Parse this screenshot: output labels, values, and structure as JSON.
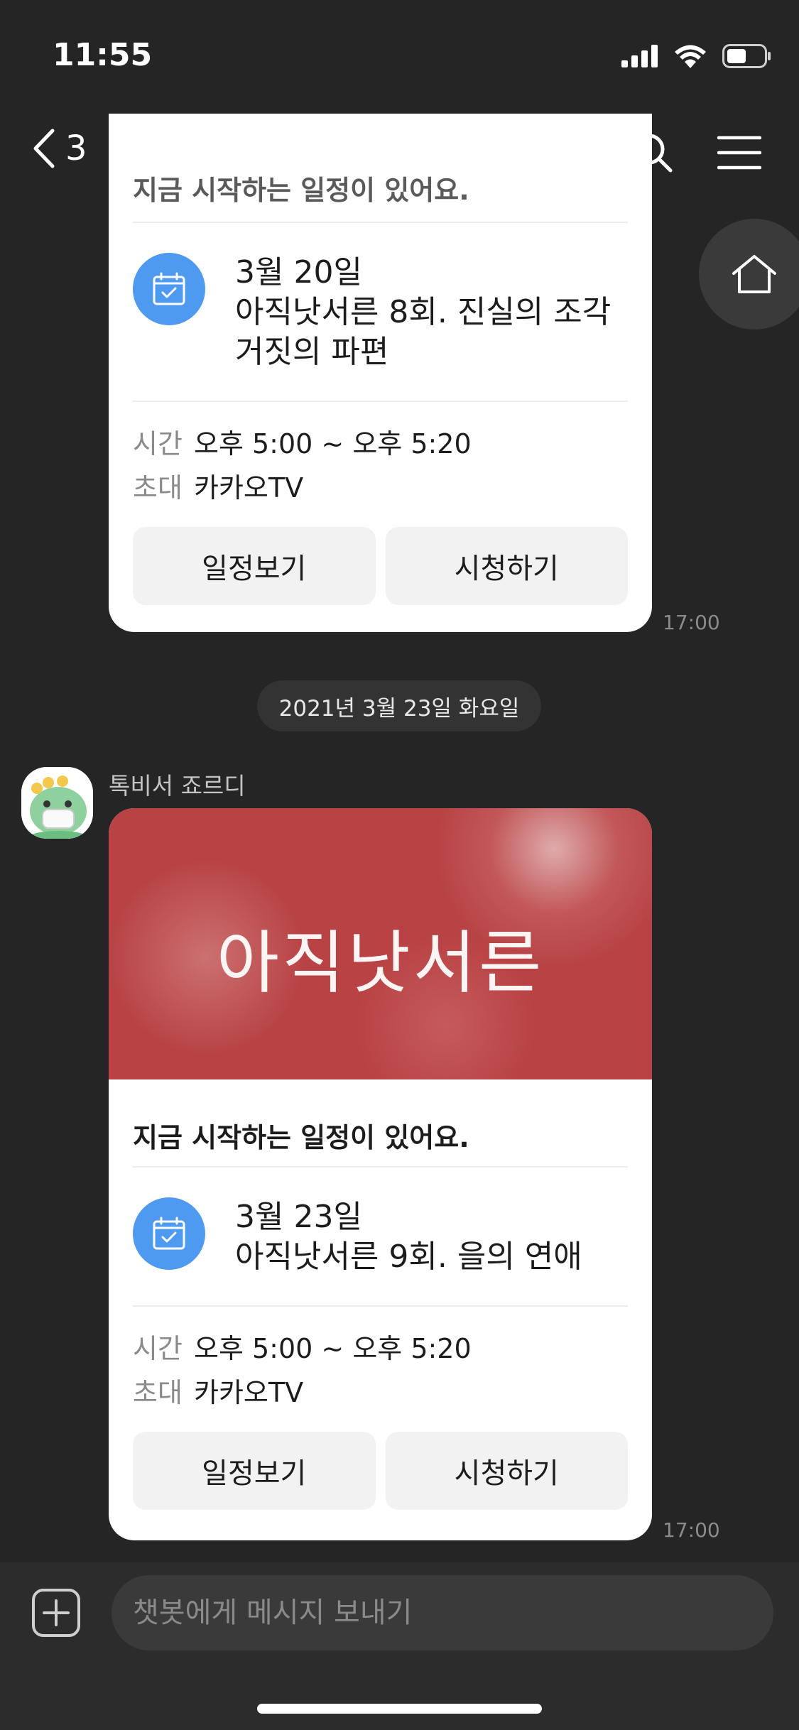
{
  "status_bar": {
    "time": "11:55"
  },
  "nav": {
    "back_count": "3",
    "title": "톡비서 죠르디"
  },
  "messages": {
    "card1": {
      "headline": "지금 시작하는 일정이 있어요.",
      "date": "3월 20일",
      "title_line1": "아직낫서른 8회. 진실의 조각",
      "title_line2": "거짓의 파편",
      "time_label": "시간",
      "time_value": "오후 5:00 ~ 오후 5:20",
      "invite_label": "초대",
      "invite_value": "카카오TV",
      "view_schedule": "일정보기",
      "watch": "시청하기",
      "timestamp": "17:00"
    },
    "date_divider": "2021년 3월 23일 화요일",
    "sender_name": "톡비서 죠르디",
    "card2": {
      "banner_text": "아직낫서른",
      "headline": "지금 시작하는 일정이 있어요.",
      "date": "3월 23일",
      "title_line1": "아직낫서른 9회. 을의 연애",
      "time_label": "시간",
      "time_value": "오후 5:00 ~ 오후 5:20",
      "invite_label": "초대",
      "invite_value": "카카오TV",
      "view_schedule": "일정보기",
      "watch": "시청하기",
      "timestamp": "17:00"
    }
  },
  "input": {
    "placeholder": "챗봇에게 메시지 보내기"
  },
  "colors": {
    "background": "#252525",
    "card": "#ffffff",
    "accent_blue": "#4e9af1",
    "banner_red": "#b84244"
  },
  "icons": [
    "signal-icon",
    "wifi-icon",
    "battery-icon",
    "back-chevron-icon",
    "search-icon",
    "menu-icon",
    "home-icon",
    "calendar-check-icon",
    "plus-icon"
  ]
}
